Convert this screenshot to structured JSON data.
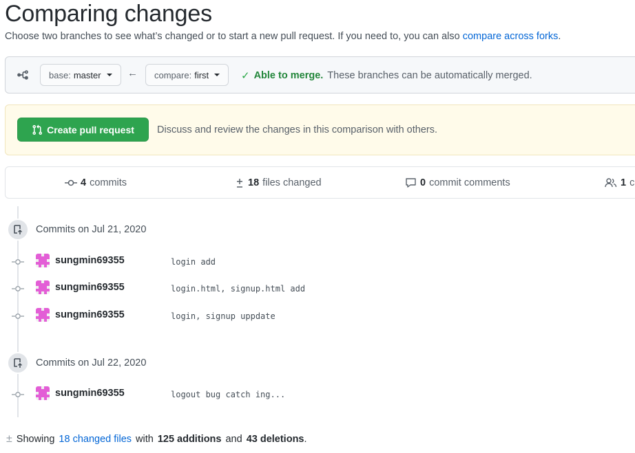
{
  "header": {
    "title": "Comparing changes",
    "subtitle_text": "Choose two branches to see what’s changed or to start a new pull request. If you need to, you can also",
    "subtitle_link": "compare across forks",
    "subtitle_end": "."
  },
  "range": {
    "base_prefix": "base:",
    "base_branch": "master",
    "compare_prefix": "compare:",
    "compare_branch": "first",
    "merge_ok": "Able to merge.",
    "merge_note": "These branches can be automatically merged."
  },
  "banner": {
    "button_label": "Create pull request",
    "text": "Discuss and review the changes in this comparison with others."
  },
  "summary": {
    "commits_count": "4",
    "commits_label": "commits",
    "files_count": "18",
    "files_label": "files changed",
    "comments_count": "0",
    "comments_label": "commit comments",
    "contributors_count": "1",
    "contributors_label": "co"
  },
  "groups": [
    {
      "title": "Commits on Jul 21, 2020",
      "commits": [
        {
          "author": "sungmin69355",
          "message": "login add"
        },
        {
          "author": "sungmin69355",
          "message": "login.html, signup.html add"
        },
        {
          "author": "sungmin69355",
          "message": "login, signup uppdate"
        }
      ]
    },
    {
      "title": "Commits on Jul 22, 2020",
      "commits": [
        {
          "author": "sungmin69355",
          "message": "logout bug catch ing..."
        }
      ]
    }
  ],
  "footer": {
    "showing": "Showing",
    "files_link": "18 changed files",
    "with": "with",
    "additions": "125 additions",
    "and": "and",
    "deletions": "43 deletions",
    "end": "."
  },
  "colors": {
    "accent_link": "#0366d6",
    "primary_green": "#2ea44f",
    "merge_green": "#22863a",
    "banner_bg": "#fffbea",
    "avatar_pink": "#e35ed6"
  }
}
